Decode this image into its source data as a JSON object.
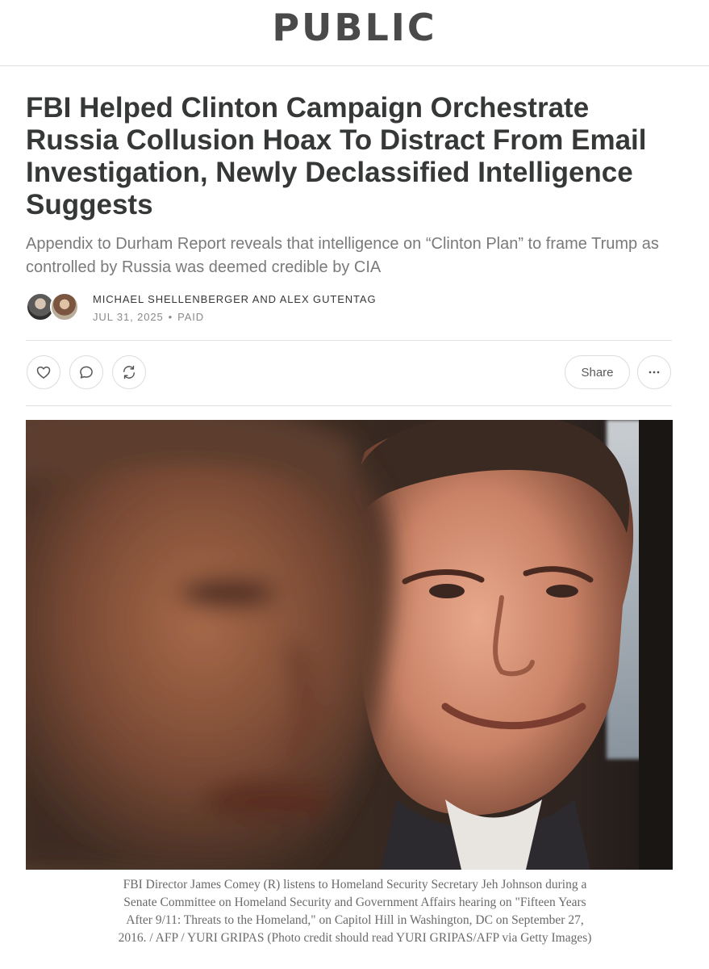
{
  "site": {
    "logo": "PUBLIC"
  },
  "article": {
    "title": "FBI Helped Clinton Campaign Orchestrate Russia Collusion Hoax To Distract From Email Investigation, Newly Declassified Intelligence Suggests",
    "subtitle": "Appendix to Durham Report reveals that intelligence on “Clinton Plan” to frame Trump as controlled by Russia was deemed credible by CIA",
    "authors": "MICHAEL SHELLENBERGER AND ALEX GUTENTAG",
    "date": "JUL 31, 2025",
    "separator": "•",
    "access": "PAID"
  },
  "actions": {
    "like_icon": "heart-icon",
    "comment_icon": "comment-icon",
    "restack_icon": "restack-icon",
    "share_label": "Share",
    "more_icon": "ellipsis-icon"
  },
  "image": {
    "caption": "FBI Director James Comey (R) listens to Homeland Security Secretary Jeh Johnson during a Senate Committee on Homeland Security and Government Affairs hearing on \"Fifteen Years After 9/11: Threats to the Homeland,\" on Capitol Hill in Washington, DC on September 27, 2016. / AFP / YURI GRIPAS (Photo credit should read YURI GRIPAS/AFP via Getty Images)"
  },
  "colors": {
    "text": "#363737",
    "muted": "#7a7a7a",
    "border": "#e3e3e3"
  }
}
